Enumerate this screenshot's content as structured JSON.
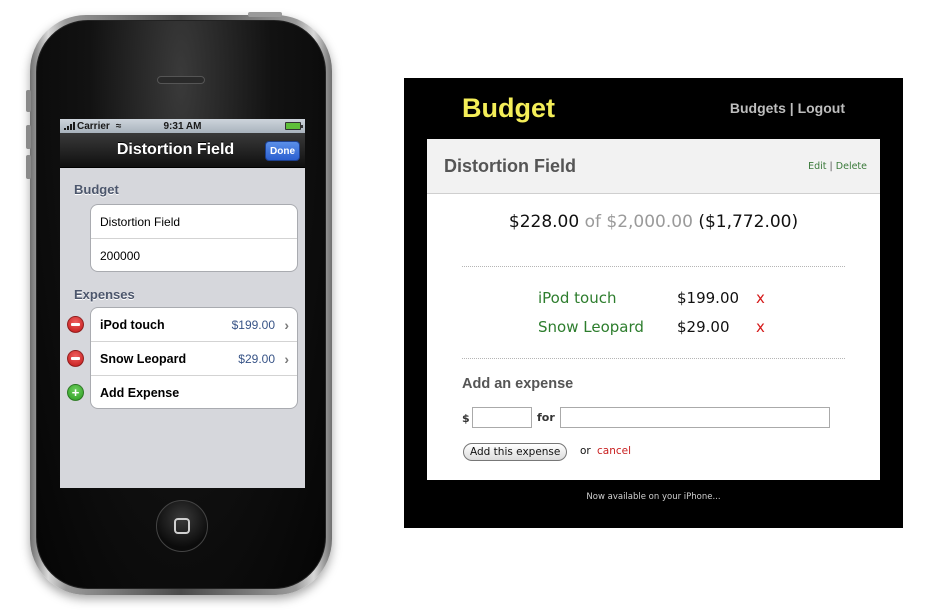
{
  "phone": {
    "status": {
      "carrier": "Carrier",
      "time": "9:31 AM"
    },
    "navbar": {
      "title": "Distortion Field",
      "done_label": "Done"
    },
    "budget_section": {
      "label": "Budget",
      "name_value": "Distortion Field",
      "amount_value": "200000"
    },
    "expenses_section": {
      "label": "Expenses",
      "items": [
        {
          "name": "iPod touch",
          "price": "$199.00"
        },
        {
          "name": "Snow Leopard",
          "price": "$29.00"
        }
      ],
      "add_label": "Add Expense"
    }
  },
  "web": {
    "brand": "Budget",
    "nav": {
      "budgets": "Budgets",
      "separator": "|",
      "logout": "Logout"
    },
    "card": {
      "title": "Distortion Field",
      "edit": "Edit",
      "link_sep": "|",
      "delete": "Delete"
    },
    "totals": {
      "spent": "$228.00",
      "of": "of",
      "budget": "$2,000.00",
      "remaining": "($1,772.00)"
    },
    "expenses": [
      {
        "name": "iPod touch",
        "amount": "$199.00",
        "delete": "x"
      },
      {
        "name": "Snow Leopard",
        "amount": "$29.00",
        "delete": "x"
      }
    ],
    "add_form": {
      "title": "Add an expense",
      "dollar": "$",
      "for": "for",
      "button": "Add this expense",
      "or": "or",
      "cancel": "cancel"
    },
    "footer": "Now available on your iPhone..."
  }
}
